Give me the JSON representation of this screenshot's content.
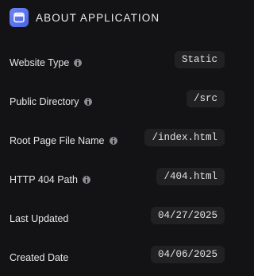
{
  "header": {
    "title": "ABOUT APPLICATION",
    "icon": "application-icon",
    "icon_color": "#5b74ee"
  },
  "fields": [
    {
      "label": "Website Type",
      "value": "Static",
      "has_info": true
    },
    {
      "label": "Public Directory",
      "value": "/src",
      "has_info": true
    },
    {
      "label": "Root Page File Name",
      "value": "/index.html",
      "has_info": true
    },
    {
      "label": "HTTP 404 Path",
      "value": "/404.html",
      "has_info": true
    },
    {
      "label": "Last Updated",
      "value": "04/27/2025",
      "has_info": false
    },
    {
      "label": "Created Date",
      "value": "04/06/2025",
      "has_info": false
    }
  ],
  "colors": {
    "background": "#131315",
    "value_chip": "#212124",
    "info_icon": "#8b8b92"
  }
}
